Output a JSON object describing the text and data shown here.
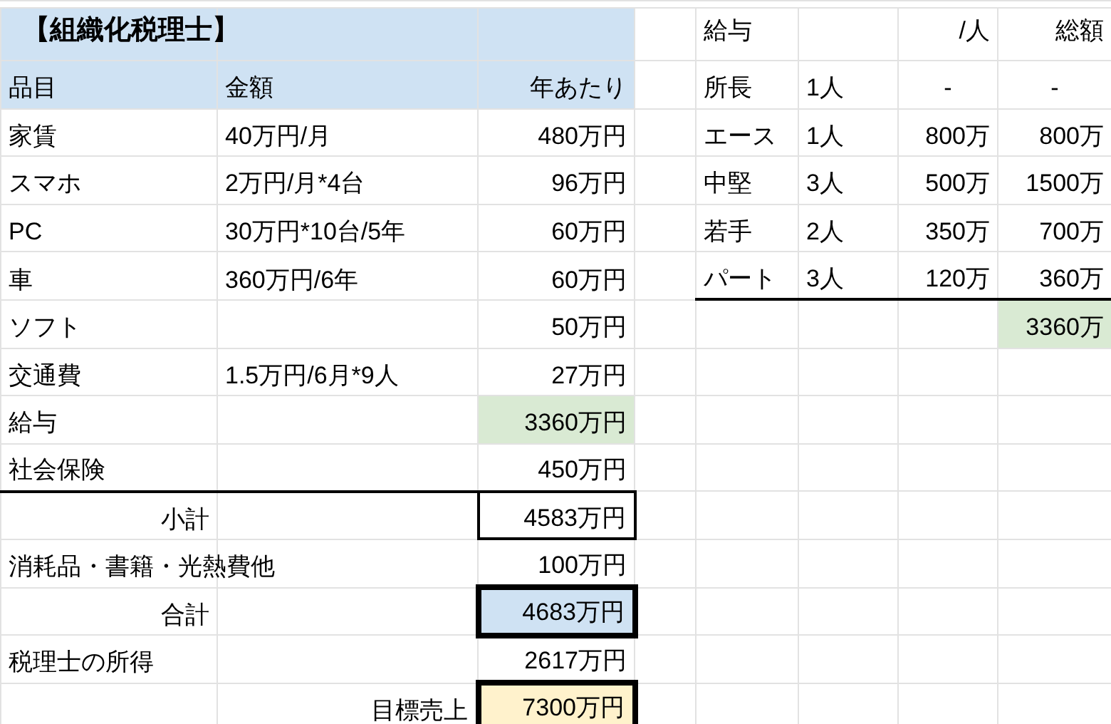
{
  "sheet": {
    "rows": [
      {
        "cells": [
          {
            "text": "【組織化税理士】",
            "bold": true,
            "color": "#cfe2f3"
          },
          {
            "color": "#cfe2f3"
          },
          {
            "color": "#cfe2f3"
          },
          null,
          {
            "text": "給与"
          },
          null,
          {
            "text": "/人",
            "right_aligned": true
          },
          {
            "text": "総額",
            "right_aligned": true
          }
        ]
      },
      {
        "cells": [
          {
            "text": "品目",
            "color": "#cfe2f3"
          },
          {
            "text": "金額",
            "color": "#cfe2f3"
          },
          {
            "text": "年あたり",
            "right_aligned": true,
            "color": "#cfe2f3"
          },
          null,
          {
            "text": "所長"
          },
          {
            "text": "1人"
          },
          {
            "text": "-",
            "centered": true
          },
          {
            "text": "-",
            "centered": true
          }
        ]
      },
      {
        "cells": [
          {
            "text": "家賃"
          },
          {
            "text": "40万円/月"
          },
          {
            "text": "480万円",
            "right_aligned": true
          },
          null,
          {
            "text": "エース"
          },
          {
            "text": "1人"
          },
          {
            "text": "800万",
            "right_aligned": true
          },
          {
            "text": "800万",
            "right_aligned": true
          }
        ]
      },
      {
        "cells": [
          {
            "text": "スマホ"
          },
          {
            "text": "2万円/月*4台"
          },
          {
            "text": "96万円",
            "right_aligned": true
          },
          null,
          {
            "text": "中堅"
          },
          {
            "text": "3人"
          },
          {
            "text": "500万",
            "right_aligned": true
          },
          {
            "text": "1500万",
            "right_aligned": true
          }
        ]
      },
      {
        "cells": [
          {
            "text": "PC"
          },
          {
            "text": "30万円*10台/5年"
          },
          {
            "text": "60万円",
            "right_aligned": true
          },
          null,
          {
            "text": "若手"
          },
          {
            "text": "2人"
          },
          {
            "text": "350万",
            "right_aligned": true
          },
          {
            "text": "700万",
            "right_aligned": true
          }
        ]
      },
      {
        "cells": [
          {
            "text": "車"
          },
          {
            "text": "360万円/6年"
          },
          {
            "text": "60万円",
            "right_aligned": true
          },
          null,
          {
            "text": "パート",
            "rule_below": true
          },
          {
            "text": "3人",
            "rule_below": true
          },
          {
            "text": "120万",
            "right_aligned": true,
            "rule_below": true
          },
          {
            "text": "360万",
            "right_aligned": true,
            "rule_below": true
          }
        ]
      },
      {
        "cells": [
          {
            "text": "ソフト"
          },
          null,
          {
            "text": "50万円",
            "right_aligned": true
          },
          null,
          null,
          null,
          null,
          {
            "text": "3360万",
            "right_aligned": true,
            "color": "#d9ead3"
          }
        ]
      },
      {
        "cells": [
          {
            "text": "交通費"
          },
          {
            "text": "1.5万円/6月*9人"
          },
          {
            "text": "27万円",
            "right_aligned": true
          },
          null,
          null,
          null,
          null,
          null
        ]
      },
      {
        "cells": [
          {
            "text": "給与"
          },
          null,
          {
            "text": "3360万円",
            "right_aligned": true,
            "color": "#d9ead3"
          },
          null,
          null,
          null,
          null,
          null
        ]
      },
      {
        "cells": [
          {
            "text": "社会保険",
            "rule_below": true
          },
          {
            "rule_below": true
          },
          {
            "text": "450万円",
            "right_aligned": true,
            "rule_below": true
          },
          null,
          null,
          null,
          null,
          null
        ]
      },
      {
        "cells": [
          {
            "text": "小計",
            "right_aligned": true
          },
          null,
          {
            "text": "4583万円",
            "right_aligned": true,
            "boxed": true
          },
          null,
          null,
          null,
          null,
          null
        ]
      },
      {
        "cells": [
          {
            "text": "消耗品・書籍・光熱費他"
          },
          null,
          {
            "text": "100万円",
            "right_aligned": true
          },
          null,
          null,
          null,
          null,
          null
        ]
      },
      {
        "cells": [
          {
            "text": "合計",
            "right_aligned": true
          },
          null,
          {
            "text": "4683万円",
            "right_aligned": true,
            "color": "#cfe2f3",
            "thick_box": true
          },
          null,
          null,
          null,
          null,
          null
        ]
      },
      {
        "cells": [
          {
            "text": "税理士の所得"
          },
          null,
          {
            "text": "2617万円",
            "right_aligned": true
          },
          null,
          null,
          null,
          null,
          null
        ]
      },
      {
        "cells": [
          null,
          {
            "text": "目標売上",
            "right_aligned": true
          },
          {
            "text": "7300万円",
            "right_aligned": true,
            "color": "#fff2cc",
            "thick_box": true
          },
          null,
          null,
          null,
          null,
          null
        ]
      }
    ]
  }
}
